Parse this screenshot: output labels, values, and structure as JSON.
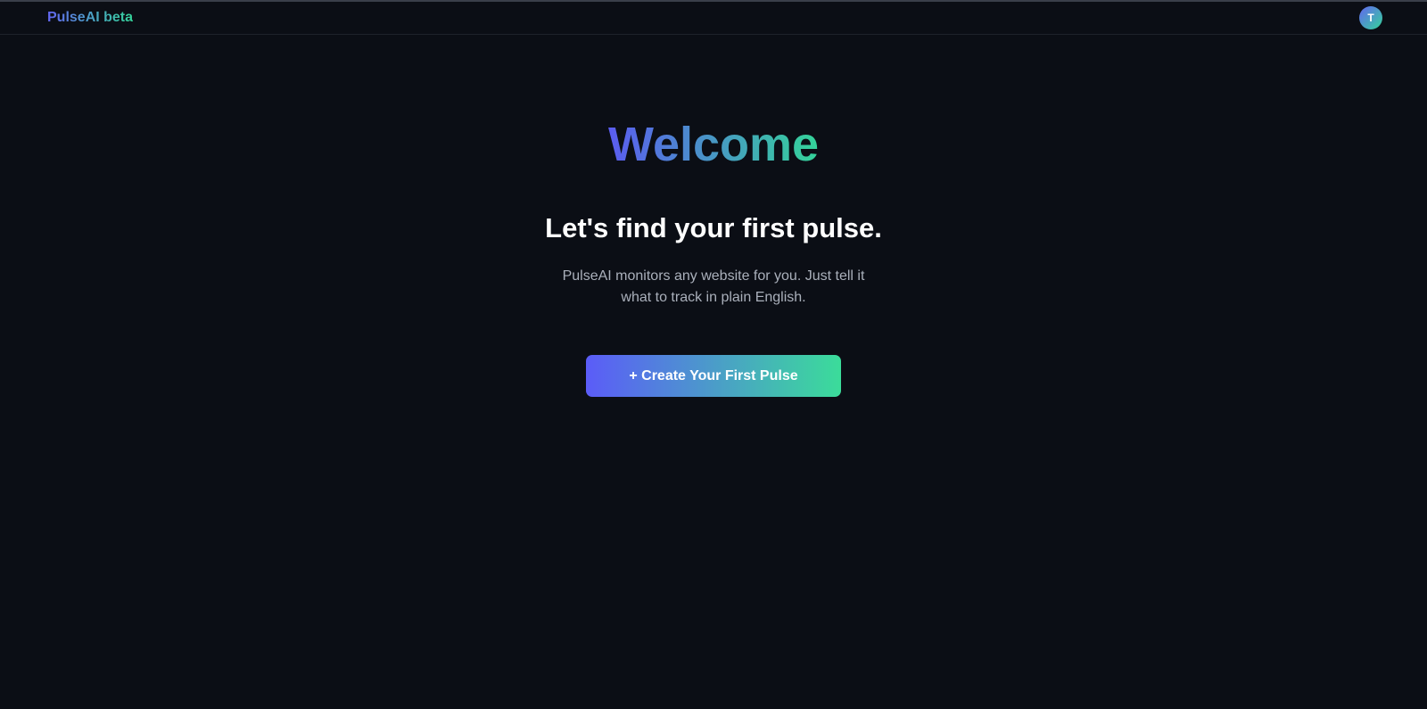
{
  "header": {
    "brand": "PulseAI beta",
    "avatar_initial": "T"
  },
  "main": {
    "title": "Welcome",
    "subheading": "Let's find your first pulse.",
    "description": "PulseAI monitors any website for you. Just tell it what to track in plain English.",
    "cta_label": "+ Create Your First Pulse"
  },
  "colors": {
    "background": "#0b0e15",
    "gradient_start": "#5b5cf8",
    "gradient_end": "#3bdc9a",
    "muted_text": "#aab0bb"
  }
}
